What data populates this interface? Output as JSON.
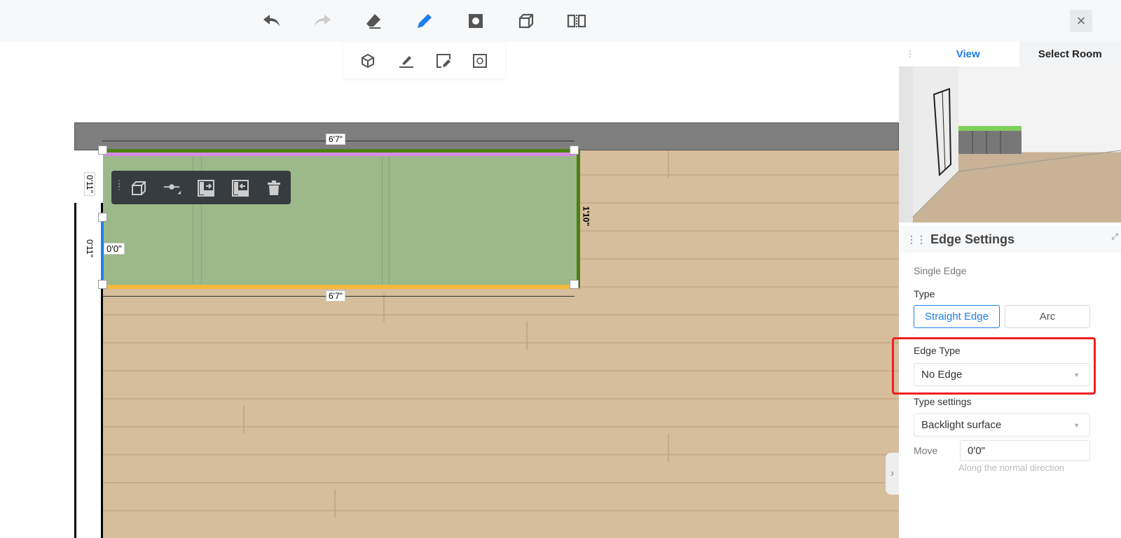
{
  "toolbar": {
    "items": [
      "undo",
      "redo",
      "eraser",
      "pencil",
      "square-dot",
      "box",
      "mirror"
    ],
    "close": "×"
  },
  "sub_toolbar": {
    "items": [
      "cube-3d",
      "draw-line",
      "edit-shape",
      "replace"
    ]
  },
  "canvas": {
    "dimensions": {
      "top": "6'7\"",
      "bottom": "6'7\"",
      "right": "1'10\"",
      "left_upper": "0'11\"",
      "left_lower": "0'11\"",
      "offset": "0'0\""
    }
  },
  "float_toolbar": {
    "items": [
      "cube",
      "node",
      "move-right",
      "move-left",
      "delete"
    ]
  },
  "view_panel": {
    "tabs": [
      "View",
      "Select Room"
    ],
    "active": "View"
  },
  "edge_settings": {
    "title": "Edge Settings",
    "mode": "Single Edge",
    "type_label": "Type",
    "type_options": [
      "Straight Edge",
      "Arc"
    ],
    "type_selected": "Straight Edge",
    "edge_type_label": "Edge Type",
    "edge_type_value": "No Edge",
    "type_settings_label": "Type settings",
    "type_settings_value": "Backlight surface",
    "move_label": "Move",
    "move_value": "0'0\"",
    "move_hint": "Along the normal direction"
  },
  "colors": {
    "accent": "#1f7ef0",
    "highlight": "#f02020"
  }
}
